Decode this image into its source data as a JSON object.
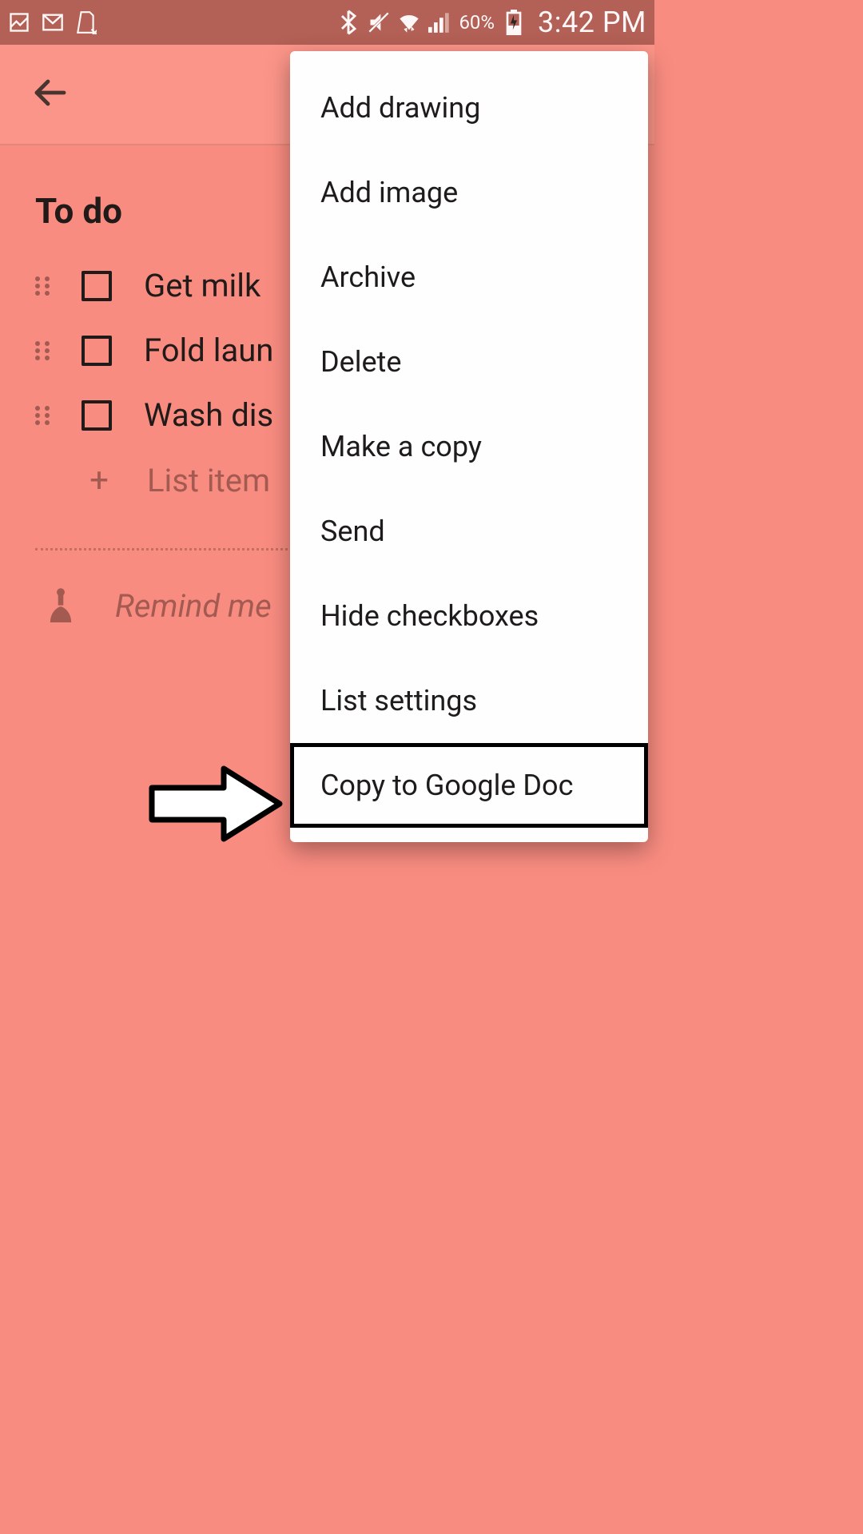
{
  "status": {
    "battery_pct": "60%",
    "time": "3:42 PM"
  },
  "note": {
    "title": "To do",
    "items": [
      {
        "label": "Get milk"
      },
      {
        "label": "Fold laun"
      },
      {
        "label": "Wash dis"
      }
    ],
    "add_placeholder": "List item",
    "remind_label": "Remind me"
  },
  "menu": {
    "items": [
      "Add drawing",
      "Add image",
      "Archive",
      "Delete",
      "Make a copy",
      "Send",
      "Hide checkboxes",
      "List settings",
      "Copy to Google Doc"
    ],
    "highlight_index": 8
  }
}
